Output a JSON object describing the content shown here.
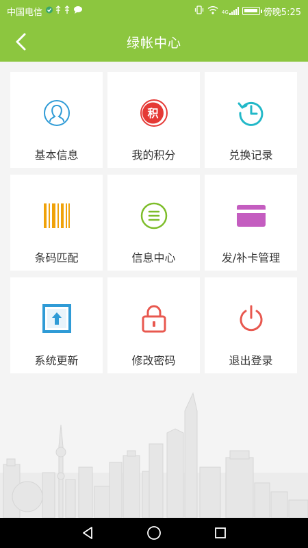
{
  "status_bar": {
    "carrier": "中国电信",
    "network": "4G",
    "time_prefix": "傍晚",
    "time": "5:25"
  },
  "header": {
    "title": "绿帐中心",
    "back_icon": "chevron-left-icon"
  },
  "colors": {
    "brand_green": "#8cc63f",
    "blue": "#2f9bd6",
    "red": "#e53935",
    "teal": "#22b8c8",
    "amber": "#f0a20a",
    "green": "#7dbd2a",
    "purple": "#c45dc0",
    "coral": "#e8584f"
  },
  "menu": [
    {
      "label": "基本信息",
      "icon": "user-avatar-icon"
    },
    {
      "label": "我的积分",
      "icon": "points-badge-icon",
      "badge_text": "积"
    },
    {
      "label": "兑换记录",
      "icon": "history-clock-icon"
    },
    {
      "label": "条码匹配",
      "icon": "barcode-icon"
    },
    {
      "label": "信息中心",
      "icon": "message-list-icon"
    },
    {
      "label": "发/补卡管理",
      "icon": "card-icon"
    },
    {
      "label": "系统更新",
      "icon": "upload-arrow-icon"
    },
    {
      "label": "修改密码",
      "icon": "lock-icon"
    },
    {
      "label": "退出登录",
      "icon": "power-icon"
    }
  ],
  "nav_bar": {
    "back": "triangle-back-icon",
    "home": "circle-home-icon",
    "recents": "square-recents-icon"
  }
}
